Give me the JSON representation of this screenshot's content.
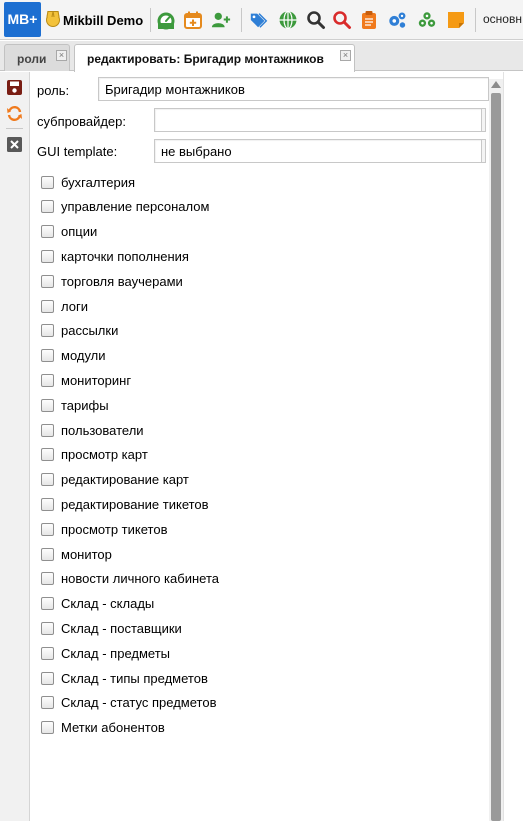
{
  "app": {
    "logo_text": "MB+",
    "brand": "Mikbill Demo",
    "toolbar_right_label": "основн",
    "toolbar_icons": [
      "dashboard-icon",
      "calendar-add-icon",
      "add-user-icon",
      "tags-icon",
      "globe-icon",
      "search-icon",
      "search-red-icon",
      "clipboard-icon",
      "gears-icon",
      "cluster-icon",
      "note-icon"
    ],
    "accent": "#1d6fd1"
  },
  "tabs": [
    {
      "label": "роли",
      "active": false
    },
    {
      "label": "редактировать: Бригадир монтажников",
      "active": true
    }
  ],
  "sidebar": {
    "buttons": [
      "save-icon",
      "refresh-icon",
      "close-icon"
    ]
  },
  "form": {
    "role_label": "роль:",
    "role_value": "Бригадир монтажников",
    "subprovider_label": "субпровайдер:",
    "subprovider_value": "",
    "gui_label": "GUI template:",
    "gui_value": "не выбрано",
    "permissions": [
      {
        "label": "бухгалтерия",
        "checked": false
      },
      {
        "label": "управление персоналом",
        "checked": false
      },
      {
        "label": "опции",
        "checked": false
      },
      {
        "label": "карточки пополнения",
        "checked": false
      },
      {
        "label": "торговля ваучерами",
        "checked": false
      },
      {
        "label": "логи",
        "checked": false
      },
      {
        "label": "рассылки",
        "checked": false
      },
      {
        "label": "модули",
        "checked": false
      },
      {
        "label": "мониторинг",
        "checked": false
      },
      {
        "label": "тарифы",
        "checked": false
      },
      {
        "label": "пользователи",
        "checked": false
      },
      {
        "label": "просмотр карт",
        "checked": false
      },
      {
        "label": "редактирование карт",
        "checked": false
      },
      {
        "label": "редактирование тикетов",
        "checked": false
      },
      {
        "label": "просмотр тикетов",
        "checked": false
      },
      {
        "label": "монитор",
        "checked": false
      },
      {
        "label": "новости личного кабинета",
        "checked": false
      },
      {
        "label": "Склад - склады",
        "checked": false
      },
      {
        "label": "Склад - поставщики",
        "checked": false
      },
      {
        "label": "Склад - предметы",
        "checked": false
      },
      {
        "label": "Склад - типы предметов",
        "checked": false
      },
      {
        "label": "Склад - статус предметов",
        "checked": false
      },
      {
        "label": "Метки абонентов",
        "checked": false
      }
    ]
  }
}
